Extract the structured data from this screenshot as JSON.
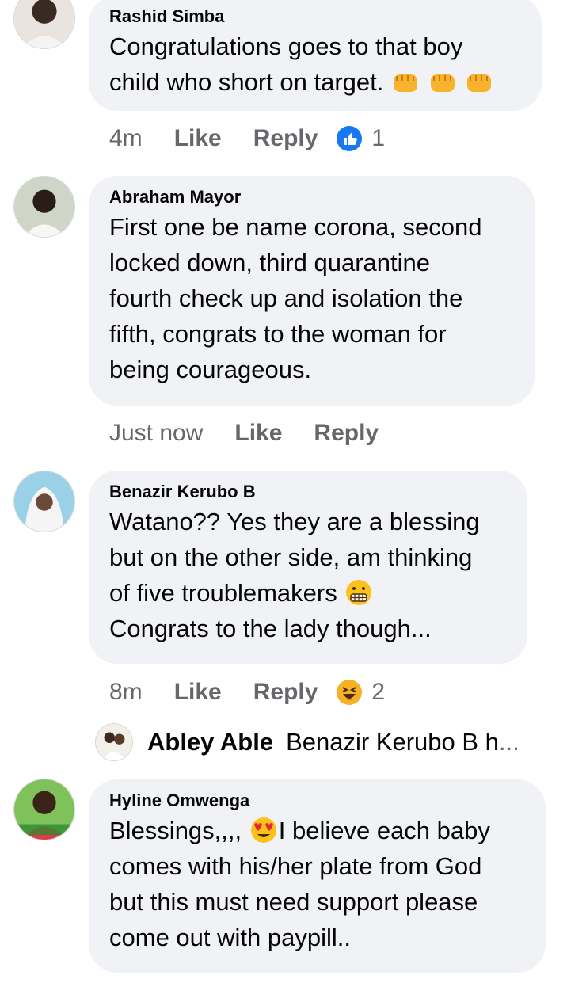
{
  "comments": [
    {
      "author": "Rashid Simba",
      "line1": "Congratulations goes to that boy",
      "line2": "child who short on target.",
      "time": "4m",
      "like": "Like",
      "reply": "Reply",
      "reaction": "like-reaction-icon",
      "reaction_count": "1"
    },
    {
      "author": "Abraham Mayor",
      "lines": [
        "First one be name corona, second",
        "locked down, third quarantine",
        "fourth check up and isolation the",
        "fifth, congrats to the woman for",
        "being courageous."
      ],
      "time": "Just now",
      "like": "Like",
      "reply": "Reply"
    },
    {
      "author": "Benazir Kerubo B",
      "line1": "Watano?? Yes they are a blessing",
      "line2": "but on the other side, am thinking",
      "line3": "of five troublemakers",
      "line4": "Congrats to the lady though...",
      "time": "8m",
      "like": "Like",
      "reply": "Reply",
      "reaction": "haha-reaction-icon",
      "reaction_count": "2",
      "reply_preview": {
        "author": "Abley Able",
        "text": "Benazir Kerubo B h",
        "more": "..."
      }
    },
    {
      "author": "Hyline Omwenga",
      "line1_a": "Blessings,,,,",
      "line1_b": "I believe each baby",
      "line2": "comes with his/her plate from God",
      "line3": "but this must need support please",
      "line4": "come out with paypill.."
    }
  ],
  "colors": {
    "bubble": "#f0f2f5",
    "meta": "#65676b",
    "like_blue": "#1877f2"
  }
}
